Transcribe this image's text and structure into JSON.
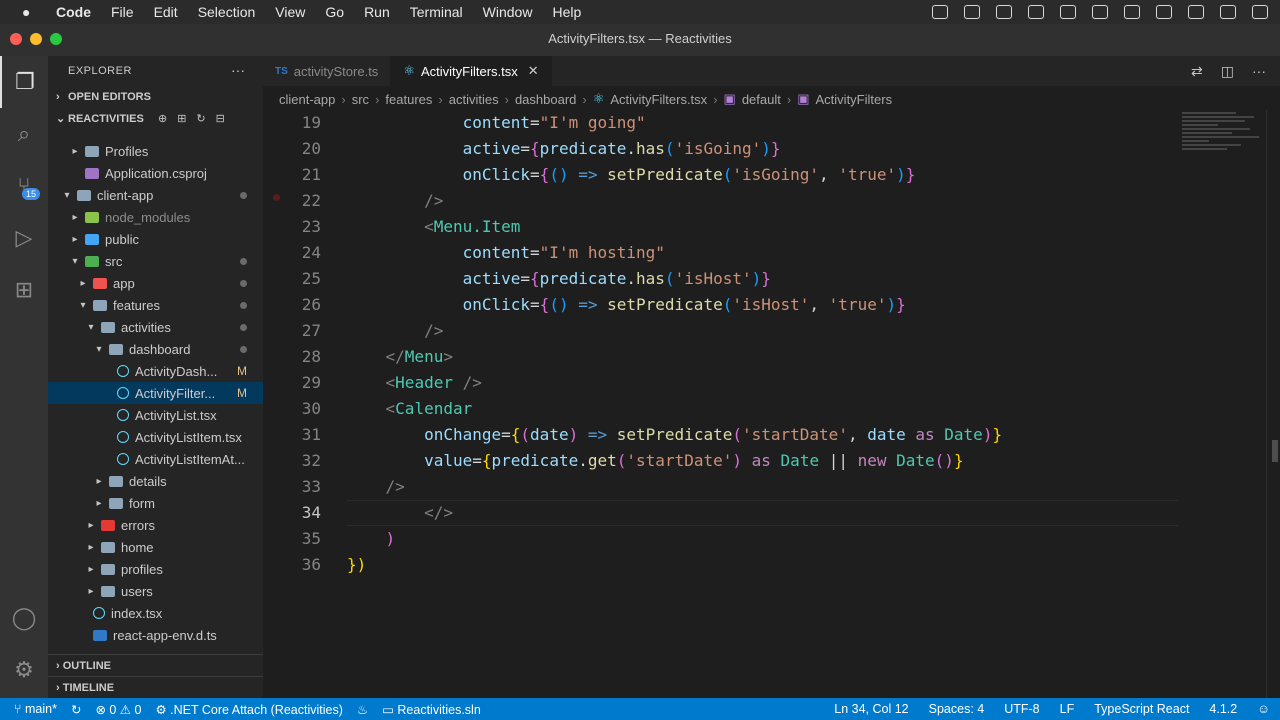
{
  "menubar": {
    "app": "Code",
    "items": [
      "File",
      "Edit",
      "Selection",
      "View",
      "Go",
      "Run",
      "Terminal",
      "Window",
      "Help"
    ]
  },
  "window": {
    "title": "ActivityFilters.tsx — Reactivities"
  },
  "activity_bar": {
    "scm_badge": "15"
  },
  "sidebar": {
    "title": "EXPLORER",
    "open_editors": "OPEN EDITORS",
    "project": "REACTIVITIES",
    "tree": [
      {
        "label": "Profiles",
        "indent": 2,
        "twisty": "▸",
        "icon": "folder"
      },
      {
        "label": "Application.csproj",
        "indent": 2,
        "twisty": "",
        "icon": "csproj"
      },
      {
        "label": "client-app",
        "indent": 1,
        "twisty": "▾",
        "icon": "folder",
        "dot": true
      },
      {
        "label": "node_modules",
        "indent": 2,
        "twisty": "▸",
        "icon": "node",
        "dim": true
      },
      {
        "label": "public",
        "indent": 2,
        "twisty": "▸",
        "icon": "public"
      },
      {
        "label": "src",
        "indent": 2,
        "twisty": "▾",
        "icon": "src",
        "dot": true
      },
      {
        "label": "app",
        "indent": 3,
        "twisty": "▸",
        "icon": "app",
        "dot": true
      },
      {
        "label": "features",
        "indent": 3,
        "twisty": "▾",
        "icon": "folder",
        "dot": true
      },
      {
        "label": "activities",
        "indent": 4,
        "twisty": "▾",
        "icon": "folder",
        "dot": true
      },
      {
        "label": "dashboard",
        "indent": 5,
        "twisty": "▾",
        "icon": "folder",
        "dot": true
      },
      {
        "label": "ActivityDash...",
        "indent": 6,
        "twisty": "",
        "icon": "react",
        "mod": "M"
      },
      {
        "label": "ActivityFilter...",
        "indent": 6,
        "twisty": "",
        "icon": "react",
        "mod": "M",
        "selected": true
      },
      {
        "label": "ActivityList.tsx",
        "indent": 6,
        "twisty": "",
        "icon": "react"
      },
      {
        "label": "ActivityListItem.tsx",
        "indent": 6,
        "twisty": "",
        "icon": "react"
      },
      {
        "label": "ActivityListItemAt...",
        "indent": 6,
        "twisty": "",
        "icon": "react"
      },
      {
        "label": "details",
        "indent": 5,
        "twisty": "▸",
        "icon": "folder"
      },
      {
        "label": "form",
        "indent": 5,
        "twisty": "▸",
        "icon": "folder"
      },
      {
        "label": "errors",
        "indent": 4,
        "twisty": "▸",
        "icon": "errors"
      },
      {
        "label": "home",
        "indent": 4,
        "twisty": "▸",
        "icon": "folder"
      },
      {
        "label": "profiles",
        "indent": 4,
        "twisty": "▸",
        "icon": "folder"
      },
      {
        "label": "users",
        "indent": 4,
        "twisty": "▸",
        "icon": "folder"
      },
      {
        "label": "index.tsx",
        "indent": 3,
        "twisty": "",
        "icon": "react"
      },
      {
        "label": "react-app-env.d.ts",
        "indent": 3,
        "twisty": "",
        "icon": "ts"
      }
    ],
    "outline": "OUTLINE",
    "timeline": "TIMELINE"
  },
  "tabs": [
    {
      "label": "activityStore.ts",
      "active": false
    },
    {
      "label": "ActivityFilters.tsx",
      "active": true
    }
  ],
  "breadcrumb": [
    "client-app",
    "src",
    "features",
    "activities",
    "dashboard",
    "ActivityFilters.tsx",
    "default",
    "ActivityFilters"
  ],
  "editor": {
    "current_line": "34",
    "lines": [
      {
        "n": "19",
        "tokens": [
          [
            "            ",
            ""
          ],
          [
            "content",
            "t-prop"
          ],
          [
            "=",
            "t-punc"
          ],
          [
            "\"I'm going\"",
            "t-str"
          ]
        ]
      },
      {
        "n": "20",
        "tokens": [
          [
            "            ",
            ""
          ],
          [
            "active",
            "t-prop"
          ],
          [
            "=",
            "t-punc"
          ],
          [
            "{",
            "t-pink"
          ],
          [
            "predicate",
            "t-prop"
          ],
          [
            ".",
            "t-punc"
          ],
          [
            "has",
            "t-fn"
          ],
          [
            "(",
            "t-bl2"
          ],
          [
            "'isGoing'",
            "t-str"
          ],
          [
            ")",
            "t-bl2"
          ],
          [
            "}",
            "t-pink"
          ]
        ]
      },
      {
        "n": "21",
        "tokens": [
          [
            "            ",
            ""
          ],
          [
            "onClick",
            "t-prop"
          ],
          [
            "=",
            "t-punc"
          ],
          [
            "{",
            "t-pink"
          ],
          [
            "()",
            "t-bl2"
          ],
          [
            " => ",
            "t-blue"
          ],
          [
            "setPredicate",
            "t-fn"
          ],
          [
            "(",
            "t-bl2"
          ],
          [
            "'isGoing'",
            "t-str"
          ],
          [
            ", ",
            "t-punc"
          ],
          [
            "'true'",
            "t-str"
          ],
          [
            ")",
            "t-bl2"
          ],
          [
            "}",
            "t-pink"
          ]
        ]
      },
      {
        "n": "22",
        "tokens": [
          [
            "        ",
            ""
          ],
          [
            "/>",
            "t-gray"
          ]
        ]
      },
      {
        "n": "23",
        "tokens": [
          [
            "        ",
            ""
          ],
          [
            "<",
            "t-gray"
          ],
          [
            "Menu.Item",
            "t-tag"
          ]
        ]
      },
      {
        "n": "24",
        "tokens": [
          [
            "            ",
            ""
          ],
          [
            "content",
            "t-prop"
          ],
          [
            "=",
            "t-punc"
          ],
          [
            "\"I'm hosting\"",
            "t-str"
          ]
        ]
      },
      {
        "n": "25",
        "tokens": [
          [
            "            ",
            ""
          ],
          [
            "active",
            "t-prop"
          ],
          [
            "=",
            "t-punc"
          ],
          [
            "{",
            "t-pink"
          ],
          [
            "predicate",
            "t-prop"
          ],
          [
            ".",
            "t-punc"
          ],
          [
            "has",
            "t-fn"
          ],
          [
            "(",
            "t-bl2"
          ],
          [
            "'isHost'",
            "t-str"
          ],
          [
            ")",
            "t-bl2"
          ],
          [
            "}",
            "t-pink"
          ]
        ]
      },
      {
        "n": "26",
        "tokens": [
          [
            "            ",
            ""
          ],
          [
            "onClick",
            "t-prop"
          ],
          [
            "=",
            "t-punc"
          ],
          [
            "{",
            "t-pink"
          ],
          [
            "()",
            "t-bl2"
          ],
          [
            " => ",
            "t-blue"
          ],
          [
            "setPredicate",
            "t-fn"
          ],
          [
            "(",
            "t-bl2"
          ],
          [
            "'isHost'",
            "t-str"
          ],
          [
            ", ",
            "t-punc"
          ],
          [
            "'true'",
            "t-str"
          ],
          [
            ")",
            "t-bl2"
          ],
          [
            "}",
            "t-pink"
          ]
        ]
      },
      {
        "n": "27",
        "tokens": [
          [
            "        ",
            ""
          ],
          [
            "/>",
            "t-gray"
          ]
        ]
      },
      {
        "n": "28",
        "tokens": [
          [
            "    ",
            ""
          ],
          [
            "</",
            "t-gray"
          ],
          [
            "Menu",
            "t-tag"
          ],
          [
            ">",
            "t-gray"
          ]
        ]
      },
      {
        "n": "29",
        "tokens": [
          [
            "    ",
            ""
          ],
          [
            "<",
            "t-gray"
          ],
          [
            "Header",
            "t-tag"
          ],
          [
            " />",
            "t-gray"
          ]
        ]
      },
      {
        "n": "30",
        "tokens": [
          [
            "    ",
            ""
          ],
          [
            "<",
            "t-gray"
          ],
          [
            "Calendar",
            "t-tag"
          ]
        ]
      },
      {
        "n": "31",
        "tokens": [
          [
            "        ",
            ""
          ],
          [
            "onChange",
            "t-prop"
          ],
          [
            "=",
            "t-punc"
          ],
          [
            "{",
            "t-brace"
          ],
          [
            "(",
            "t-pink"
          ],
          [
            "date",
            "t-prop"
          ],
          [
            ")",
            "t-pink"
          ],
          [
            " => ",
            "t-blue"
          ],
          [
            "setPredicate",
            "t-fn"
          ],
          [
            "(",
            "t-pink"
          ],
          [
            "'startDate'",
            "t-str"
          ],
          [
            ", ",
            "t-punc"
          ],
          [
            "date",
            "t-prop"
          ],
          [
            " as ",
            "t-kw"
          ],
          [
            "Date",
            "t-type"
          ],
          [
            ")",
            "t-pink"
          ],
          [
            "}",
            "t-brace"
          ]
        ]
      },
      {
        "n": "32",
        "tokens": [
          [
            "        ",
            ""
          ],
          [
            "value",
            "t-prop"
          ],
          [
            "=",
            "t-punc"
          ],
          [
            "{",
            "t-brace"
          ],
          [
            "predicate",
            "t-prop"
          ],
          [
            ".",
            "t-punc"
          ],
          [
            "get",
            "t-fn"
          ],
          [
            "(",
            "t-pink"
          ],
          [
            "'startDate'",
            "t-str"
          ],
          [
            ")",
            "t-pink"
          ],
          [
            " as ",
            "t-kw"
          ],
          [
            "Date",
            "t-type"
          ],
          [
            " || ",
            "t-punc"
          ],
          [
            "new ",
            "t-kw"
          ],
          [
            "Date",
            "t-type"
          ],
          [
            "()",
            "t-pink"
          ],
          [
            "}",
            "t-brace"
          ]
        ]
      },
      {
        "n": "33",
        "tokens": [
          [
            "    ",
            ""
          ],
          [
            "/>",
            "t-gray"
          ]
        ]
      },
      {
        "n": "34",
        "tokens": [
          [
            "        ",
            ""
          ],
          [
            "</>",
            "t-gray"
          ]
        ]
      },
      {
        "n": "35",
        "tokens": [
          [
            "    ",
            ""
          ],
          [
            ")",
            "t-pink"
          ]
        ]
      },
      {
        "n": "36",
        "tokens": [
          [
            "",
            ""
          ],
          [
            "})",
            "t-brace"
          ]
        ]
      }
    ]
  },
  "status": {
    "branch": "main*",
    "problems": "⊗ 0  ⚠ 0",
    "debug": ".NET Core Attach (Reactivities)",
    "solution": "Reactivities.sln",
    "cursor": "Ln 34, Col 12",
    "spaces": "Spaces: 4",
    "encoding": "UTF-8",
    "eol": "LF",
    "language": "TypeScript React",
    "ts_version": "4.1.2"
  },
  "colors": {
    "accent": "#007acc",
    "selection": "#04395e"
  }
}
